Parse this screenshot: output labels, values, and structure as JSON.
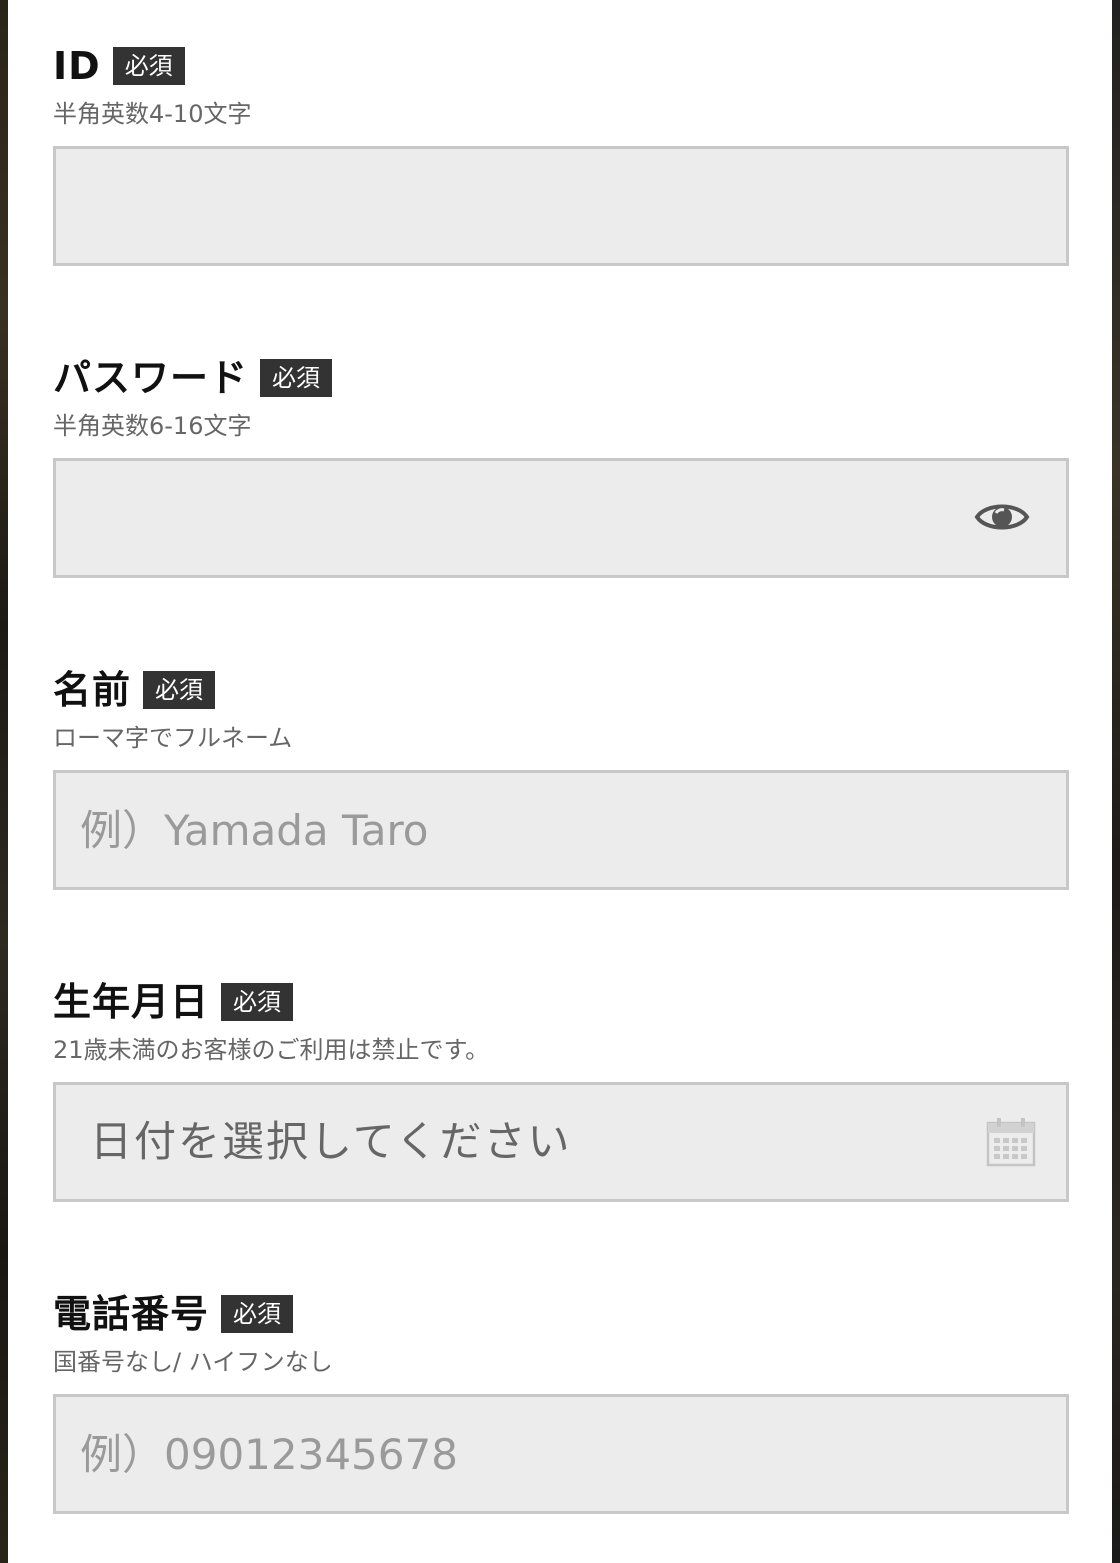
{
  "form": {
    "required_badge": "必須",
    "fields": [
      {
        "label": "ID",
        "hint": "半角英数4-10文字",
        "value": "",
        "placeholder": ""
      },
      {
        "label": "パスワード",
        "hint": "半角英数6-16文字",
        "value": "",
        "placeholder": "",
        "toggle_icon": "eye-icon"
      },
      {
        "label": "名前",
        "hint": "ローマ字でフルネーム",
        "value": "",
        "placeholder": "例）Yamada Taro"
      },
      {
        "label": "生年月日",
        "hint": "21歳未満のお客様のご利用は禁止です。",
        "value": "日付を選択してください",
        "icon": "calendar-icon"
      },
      {
        "label": "電話番号",
        "hint": "国番号なし/ ハイフンなし",
        "value": "",
        "placeholder": "例）09012345678"
      }
    ]
  },
  "colors": {
    "badge_background": "#333333",
    "input_background": "#ececec",
    "input_border": "#c8c8c8",
    "hint_text": "#666666",
    "placeholder_text": "#9a9a9a"
  }
}
